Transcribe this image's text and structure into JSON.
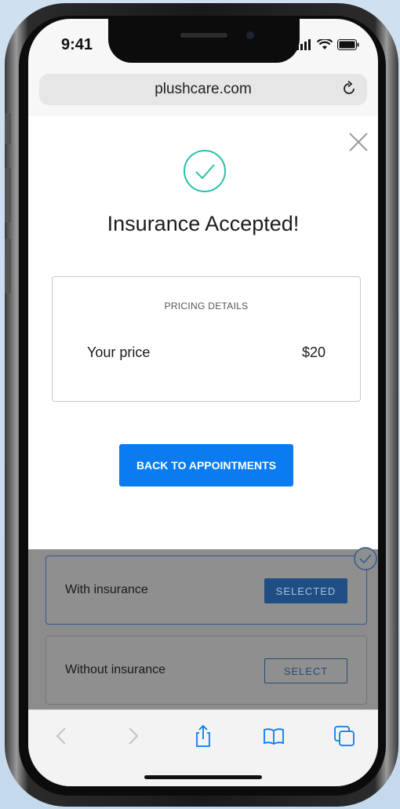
{
  "status": {
    "time": "9:41"
  },
  "browser": {
    "url": "plushcare.com"
  },
  "modal": {
    "title": "Insurance Accepted!",
    "pricing": {
      "heading": "PRICING DETAILS",
      "price_label": "Your price",
      "price_value": "$20"
    },
    "back_button": "BACK TO APPOINTMENTS"
  },
  "options": [
    {
      "label": "With insurance",
      "button": "SELECTED"
    },
    {
      "label": "Without insurance",
      "button": "SELECT"
    }
  ],
  "colors": {
    "accent": "#0a7cf0",
    "check": "#2bbfa8",
    "selected_button": "#1f4e85"
  },
  "toolbar_icons": [
    "back-icon",
    "forward-icon",
    "share-icon",
    "bookmarks-icon",
    "tabs-icon"
  ]
}
